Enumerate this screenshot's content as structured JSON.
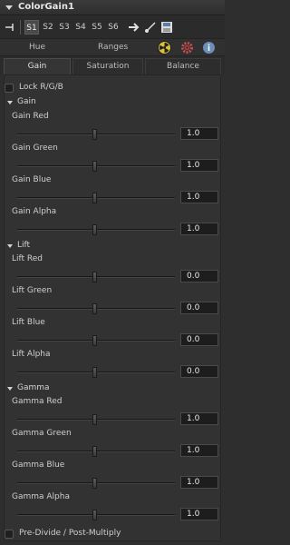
{
  "panel": {
    "title": "ColorGain1"
  },
  "toolbar": {
    "slots": [
      "S1",
      "S2",
      "S3",
      "S4",
      "S5",
      "S6"
    ],
    "active_slot": "S1"
  },
  "top_tabs": {
    "hue": "Hue",
    "ranges": "Ranges"
  },
  "sub_tabs": {
    "gain": "Gain",
    "saturation": "Saturation",
    "balance": "Balance",
    "active": "Gain"
  },
  "lock_rgb": {
    "label": "Lock R/G/B"
  },
  "groups": {
    "gain": {
      "label": "Gain",
      "controls": [
        {
          "label": "Gain Red",
          "value": "1.0"
        },
        {
          "label": "Gain Green",
          "value": "1.0"
        },
        {
          "label": "Gain Blue",
          "value": "1.0"
        },
        {
          "label": "Gain Alpha",
          "value": "1.0"
        }
      ]
    },
    "lift": {
      "label": "Lift",
      "controls": [
        {
          "label": "Lift Red",
          "value": "0.0"
        },
        {
          "label": "Lift Green",
          "value": "0.0"
        },
        {
          "label": "Lift Blue",
          "value": "0.0"
        },
        {
          "label": "Lift Alpha",
          "value": "0.0"
        }
      ]
    },
    "gamma": {
      "label": "Gamma",
      "controls": [
        {
          "label": "Gamma Red",
          "value": "1.0"
        },
        {
          "label": "Gamma Green",
          "value": "1.0"
        },
        {
          "label": "Gamma Blue",
          "value": "1.0"
        },
        {
          "label": "Gamma Alpha",
          "value": "1.0"
        }
      ]
    }
  },
  "pre_divide": {
    "label": "Pre-Divide / Post-Multiply"
  },
  "icons": [
    "collapse-arrow-icon",
    "pin-icon",
    "forward-arrow-icon",
    "pick-icon",
    "save-icon",
    "radiation-icon",
    "gear-icon",
    "info-icon"
  ],
  "colors": {
    "panel_bg": "#2e2e2e",
    "field_bg": "#1d1d1d",
    "text": "#c8c8c8"
  }
}
